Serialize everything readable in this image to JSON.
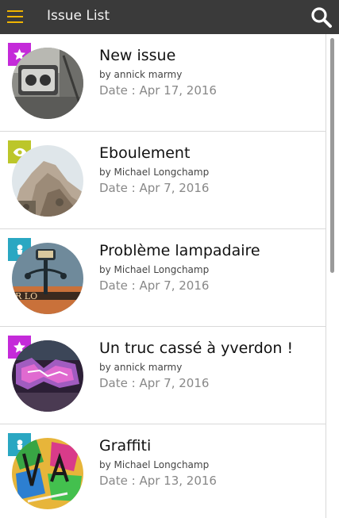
{
  "header": {
    "title": "Issue List",
    "menu_icon": "hamburger-menu-icon",
    "search_icon": "search-icon"
  },
  "colors": {
    "topbar": "#3a3a3a",
    "menu_accent": "#f0b400",
    "badge_star": "#c42ad9",
    "badge_eye": "#bcc62a",
    "badge_person": "#2aa7c2"
  },
  "issues": [
    {
      "title": "New issue",
      "author": "by annick marmy",
      "date": "Date : Apr 17, 2016",
      "badge_icon": "star-icon"
    },
    {
      "title": "Eboulement",
      "author": "by Michael Longchamp",
      "date": "Date : Apr 7, 2016",
      "badge_icon": "eye-icon"
    },
    {
      "title": "Problème lampadaire",
      "author": "by Michael Longchamp",
      "date": "Date : Apr 7, 2016",
      "badge_icon": "person-icon"
    },
    {
      "title": "Un truc cassé à yverdon !",
      "author": "by annick marmy",
      "date": "Date : Apr 7, 2016",
      "badge_icon": "star-icon"
    },
    {
      "title": "Graffiti",
      "author": "by Michael Longchamp",
      "date": "Date : Apr 13, 2016",
      "badge_icon": "person-icon"
    }
  ]
}
